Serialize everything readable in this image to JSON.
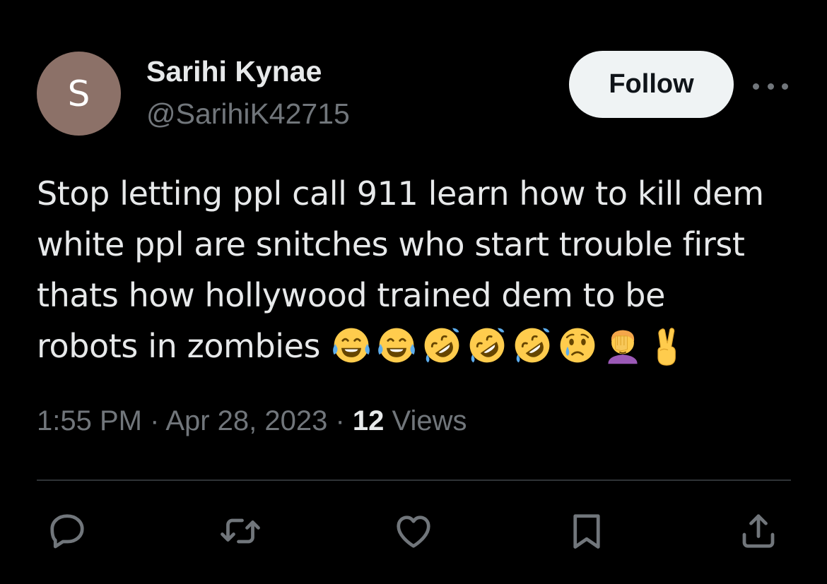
{
  "author": {
    "avatar_initial": "S",
    "avatar_color": "#8c7168",
    "name": "Sarihi Kynae",
    "handle": "@SarihiK42715"
  },
  "header": {
    "follow_label": "Follow",
    "follow_bg": "#eff3f4",
    "more_icon": "more-horizontal-icon"
  },
  "tweet": {
    "text_lines": [
      "Stop letting ppl call 911 learn how to kill dem",
      "white ppl are snitches who start trouble first",
      "thats how hollywood trained dem to be",
      "robots in zombies "
    ],
    "emojis": [
      "joy-emoji",
      "joy-emoji",
      "rofl-emoji",
      "rofl-emoji",
      "rofl-emoji",
      "crying-face-emoji",
      "facepalm-emoji",
      "victory-hand-emoji"
    ]
  },
  "meta": {
    "time": "1:55 PM",
    "separator1": " · ",
    "date": "Apr 28, 2023",
    "separator2": " · ",
    "views_count": "12",
    "views_label": " Views"
  },
  "actions": [
    {
      "name": "reply",
      "icon": "reply-icon"
    },
    {
      "name": "retweet",
      "icon": "retweet-icon"
    },
    {
      "name": "like",
      "icon": "heart-icon"
    },
    {
      "name": "bookmark",
      "icon": "bookmark-icon"
    },
    {
      "name": "share",
      "icon": "share-icon"
    }
  ],
  "colors": {
    "background": "#000000",
    "text": "#e7e9ea",
    "secondary_text": "#71767b",
    "divider": "#2f3336"
  }
}
